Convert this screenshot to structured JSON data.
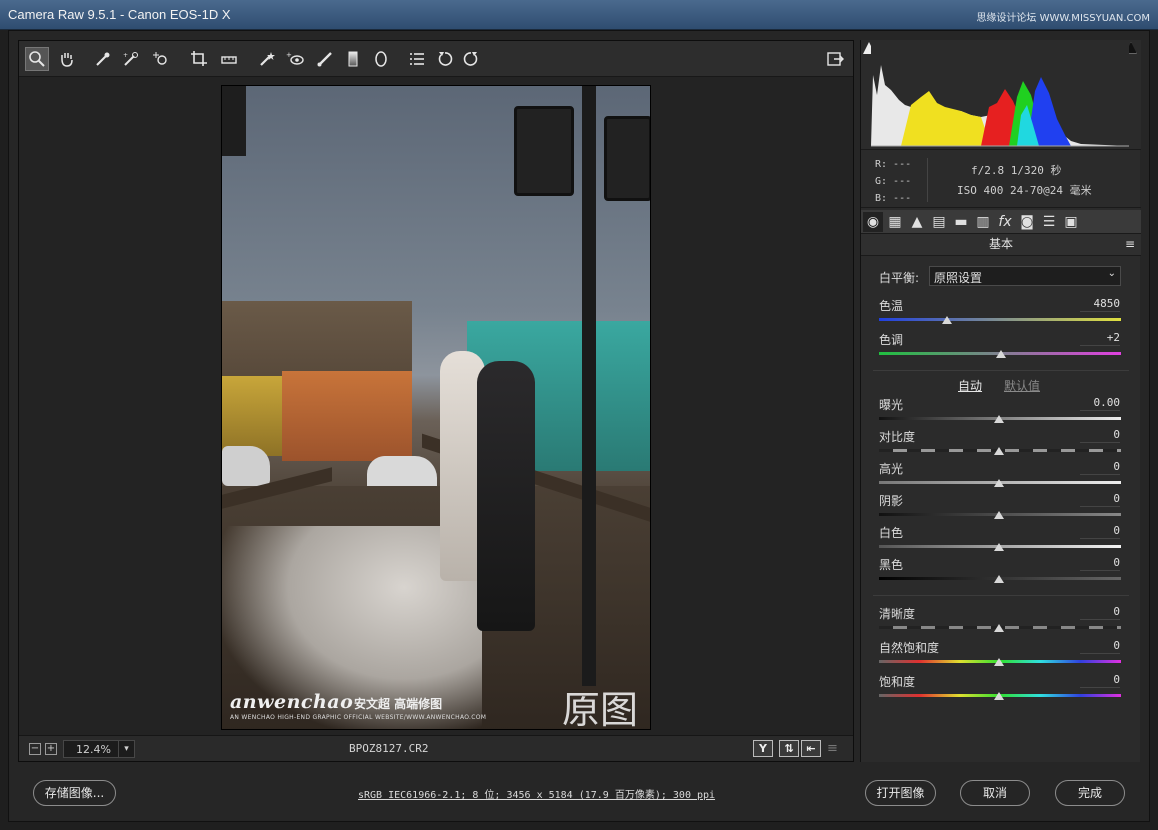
{
  "window": {
    "title": "Camera Raw 9.5.1 -  Canon EOS-1D X",
    "watermark": "思缘设计论坛 WWW.MISSYUAN.COM"
  },
  "toolbar": {
    "tools": [
      "zoom-tool",
      "hand-tool",
      "white-balance-tool",
      "color-sampler-tool",
      "targeted-adjustment-tool",
      "crop-tool",
      "straighten-tool",
      "spot-removal-tool",
      "red-eye-tool",
      "adjustment-brush-tool",
      "graduated-filter-tool",
      "radial-filter-tool",
      "presets-list",
      "rotate-ccw",
      "rotate-cw"
    ],
    "open_prefs_icon": "open-dialog-icon"
  },
  "photo": {
    "watermark_main": "anwenchao",
    "watermark_cn": "安文超 高端修图",
    "watermark_sub": "AN WENCHAO HIGH-END GRAPHIC OFFICIAL WEBSITE/WWW.ANWENCHAO.COM",
    "caption": "原图"
  },
  "status": {
    "zoom": "12.4%",
    "filename": "BPOZ8127.CR2",
    "view_y": "Y"
  },
  "histogram": {
    "rgb": [
      "R: ---",
      "G: ---",
      "B: ---"
    ],
    "aperture_shutter": "f/2.8  1/320 秒",
    "iso_lens": "ISO 400  24-70@24 毫米"
  },
  "panel": {
    "tabs": [
      "basic-icon",
      "tone-curve-icon",
      "detail-icon",
      "hsl-icon",
      "split-toning-icon",
      "lens-icon",
      "fx-icon",
      "camera-calibration-icon",
      "presets-icon",
      "snapshots-icon"
    ],
    "title": "基本",
    "wb_label": "白平衡:",
    "wb_value": "原照设置",
    "temp_label": "色温",
    "temp_value": "4850",
    "tint_label": "色调",
    "tint_value": "+2",
    "auto": "自动",
    "default": "默认值",
    "sliders": [
      {
        "label": "曝光",
        "value": "0.00"
      },
      {
        "label": "对比度",
        "value": "0"
      },
      {
        "label": "高光",
        "value": "0"
      },
      {
        "label": "阴影",
        "value": "0"
      },
      {
        "label": "白色",
        "value": "0"
      },
      {
        "label": "黑色",
        "value": "0"
      }
    ],
    "presence": [
      {
        "label": "清晰度",
        "value": "0"
      },
      {
        "label": "自然饱和度",
        "value": "0"
      },
      {
        "label": "饱和度",
        "value": "0"
      }
    ]
  },
  "bottom": {
    "save": "存储图像...",
    "info": "sRGB IEC61966-2.1; 8 位; 3456 x 5184 (17.9 百万像素); 300 ppi",
    "open": "打开图像",
    "cancel": "取消",
    "done": "完成"
  }
}
